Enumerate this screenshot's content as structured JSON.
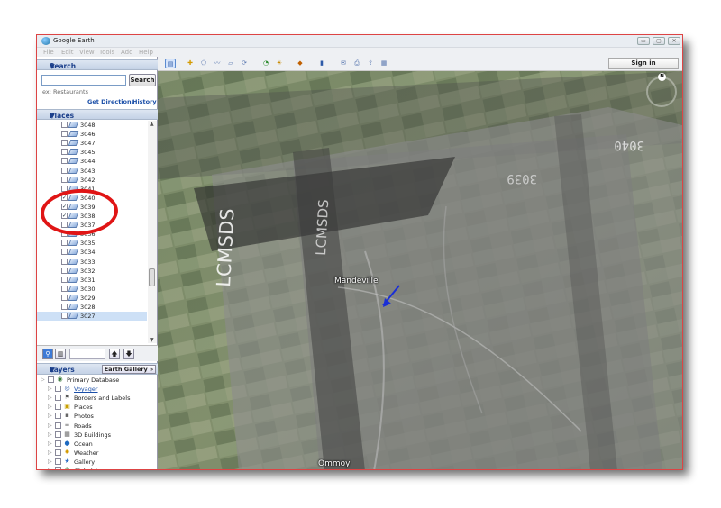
{
  "window": {
    "title": "Google Earth",
    "controls": [
      "▭",
      "▢",
      "✕"
    ]
  },
  "menu": [
    "File",
    "Edit",
    "View",
    "Tools",
    "Add",
    "Help"
  ],
  "search": {
    "header": "Search",
    "input_value": "",
    "button": "Search",
    "hint": "ex: Restaurants",
    "get_directions": "Get Directions",
    "history": "History"
  },
  "places": {
    "header": "Places",
    "items": [
      {
        "label": "3048",
        "checked": false
      },
      {
        "label": "3046",
        "checked": false
      },
      {
        "label": "3047",
        "checked": false
      },
      {
        "label": "3045",
        "checked": false
      },
      {
        "label": "3044",
        "checked": false
      },
      {
        "label": "3043",
        "checked": false
      },
      {
        "label": "3042",
        "checked": false
      },
      {
        "label": "3041",
        "checked": false
      },
      {
        "label": "3040",
        "checked": true
      },
      {
        "label": "3039",
        "checked": true
      },
      {
        "label": "3038",
        "checked": true
      },
      {
        "label": "3037",
        "checked": false
      },
      {
        "label": "3036",
        "checked": false
      },
      {
        "label": "3035",
        "checked": false
      },
      {
        "label": "3034",
        "checked": false
      },
      {
        "label": "3033",
        "checked": false
      },
      {
        "label": "3032",
        "checked": false
      },
      {
        "label": "3031",
        "checked": false
      },
      {
        "label": "3030",
        "checked": false
      },
      {
        "label": "3029",
        "checked": false
      },
      {
        "label": "3028",
        "checked": false
      },
      {
        "label": "3027",
        "checked": false,
        "selected": true
      }
    ]
  },
  "layers": {
    "header": "Layers",
    "gallery_button": "Earth Gallery »",
    "items": [
      {
        "label": "Primary Database",
        "icon": "globe-icon",
        "link": false
      },
      {
        "label": "Voyager",
        "icon": "voyager-icon",
        "link": true
      },
      {
        "label": "Borders and Labels",
        "icon": "flag-icon",
        "link": false
      },
      {
        "label": "Places",
        "icon": "places-icon",
        "link": false
      },
      {
        "label": "Photos",
        "icon": "photo-icon",
        "link": false
      },
      {
        "label": "Roads",
        "icon": "road-icon",
        "link": false
      },
      {
        "label": "3D Buildings",
        "icon": "building-icon",
        "link": false
      },
      {
        "label": "Ocean",
        "icon": "ocean-icon",
        "link": false
      },
      {
        "label": "Weather",
        "icon": "sun-icon",
        "link": false
      },
      {
        "label": "Gallery",
        "icon": "star-icon",
        "link": false
      },
      {
        "label": "Global Awareness",
        "icon": "globe-icon",
        "link": false
      },
      {
        "label": "More",
        "icon": "folder-icon",
        "link": false
      }
    ]
  },
  "toolbar": {
    "sign_in": "Sign in"
  },
  "map": {
    "labels": {
      "mandeville": "Mandeville",
      "ommoy": "Ommoy"
    },
    "overlay_texts": {
      "lcmsds_left": "LCMSDS",
      "lcmsds_mid": "LCMSDS",
      "num_3039": "3039",
      "num_3040": "3040"
    },
    "compass": "N"
  },
  "colors": {
    "annotation_red": "#e01515",
    "arrow_blue": "#1a2fd6",
    "header_blue": "#1b3f8b"
  }
}
